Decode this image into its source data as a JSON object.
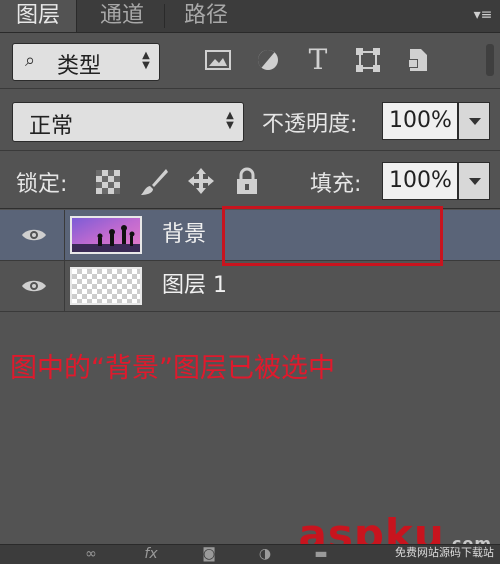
{
  "tabs": [
    {
      "label": "图层"
    },
    {
      "label": "通道"
    },
    {
      "label": "路径"
    }
  ],
  "filter": {
    "label": "类型",
    "icons": [
      "image-filter-icon",
      "adjustment-filter-icon",
      "type-filter-icon",
      "shape-filter-icon",
      "smart-object-filter-icon"
    ],
    "type_glyph": "T"
  },
  "blend": {
    "mode": "正常",
    "opacity_label": "不透明度:",
    "opacity_value": "100%"
  },
  "lock": {
    "label": "锁定:",
    "fill_label": "填充:",
    "fill_value": "100%"
  },
  "layers": [
    {
      "name": "背景",
      "selected": true
    },
    {
      "name": "图层 1",
      "selected": false
    }
  ],
  "annotation": "图中的“背景”图层已被选中",
  "watermark": {
    "text": "aspku",
    "suffix": ".com",
    "small": "免费网站源码下载站"
  },
  "colors": {
    "panel": "#535353",
    "selected_row": "#5a6478",
    "annotation_red": "#e0192c"
  }
}
